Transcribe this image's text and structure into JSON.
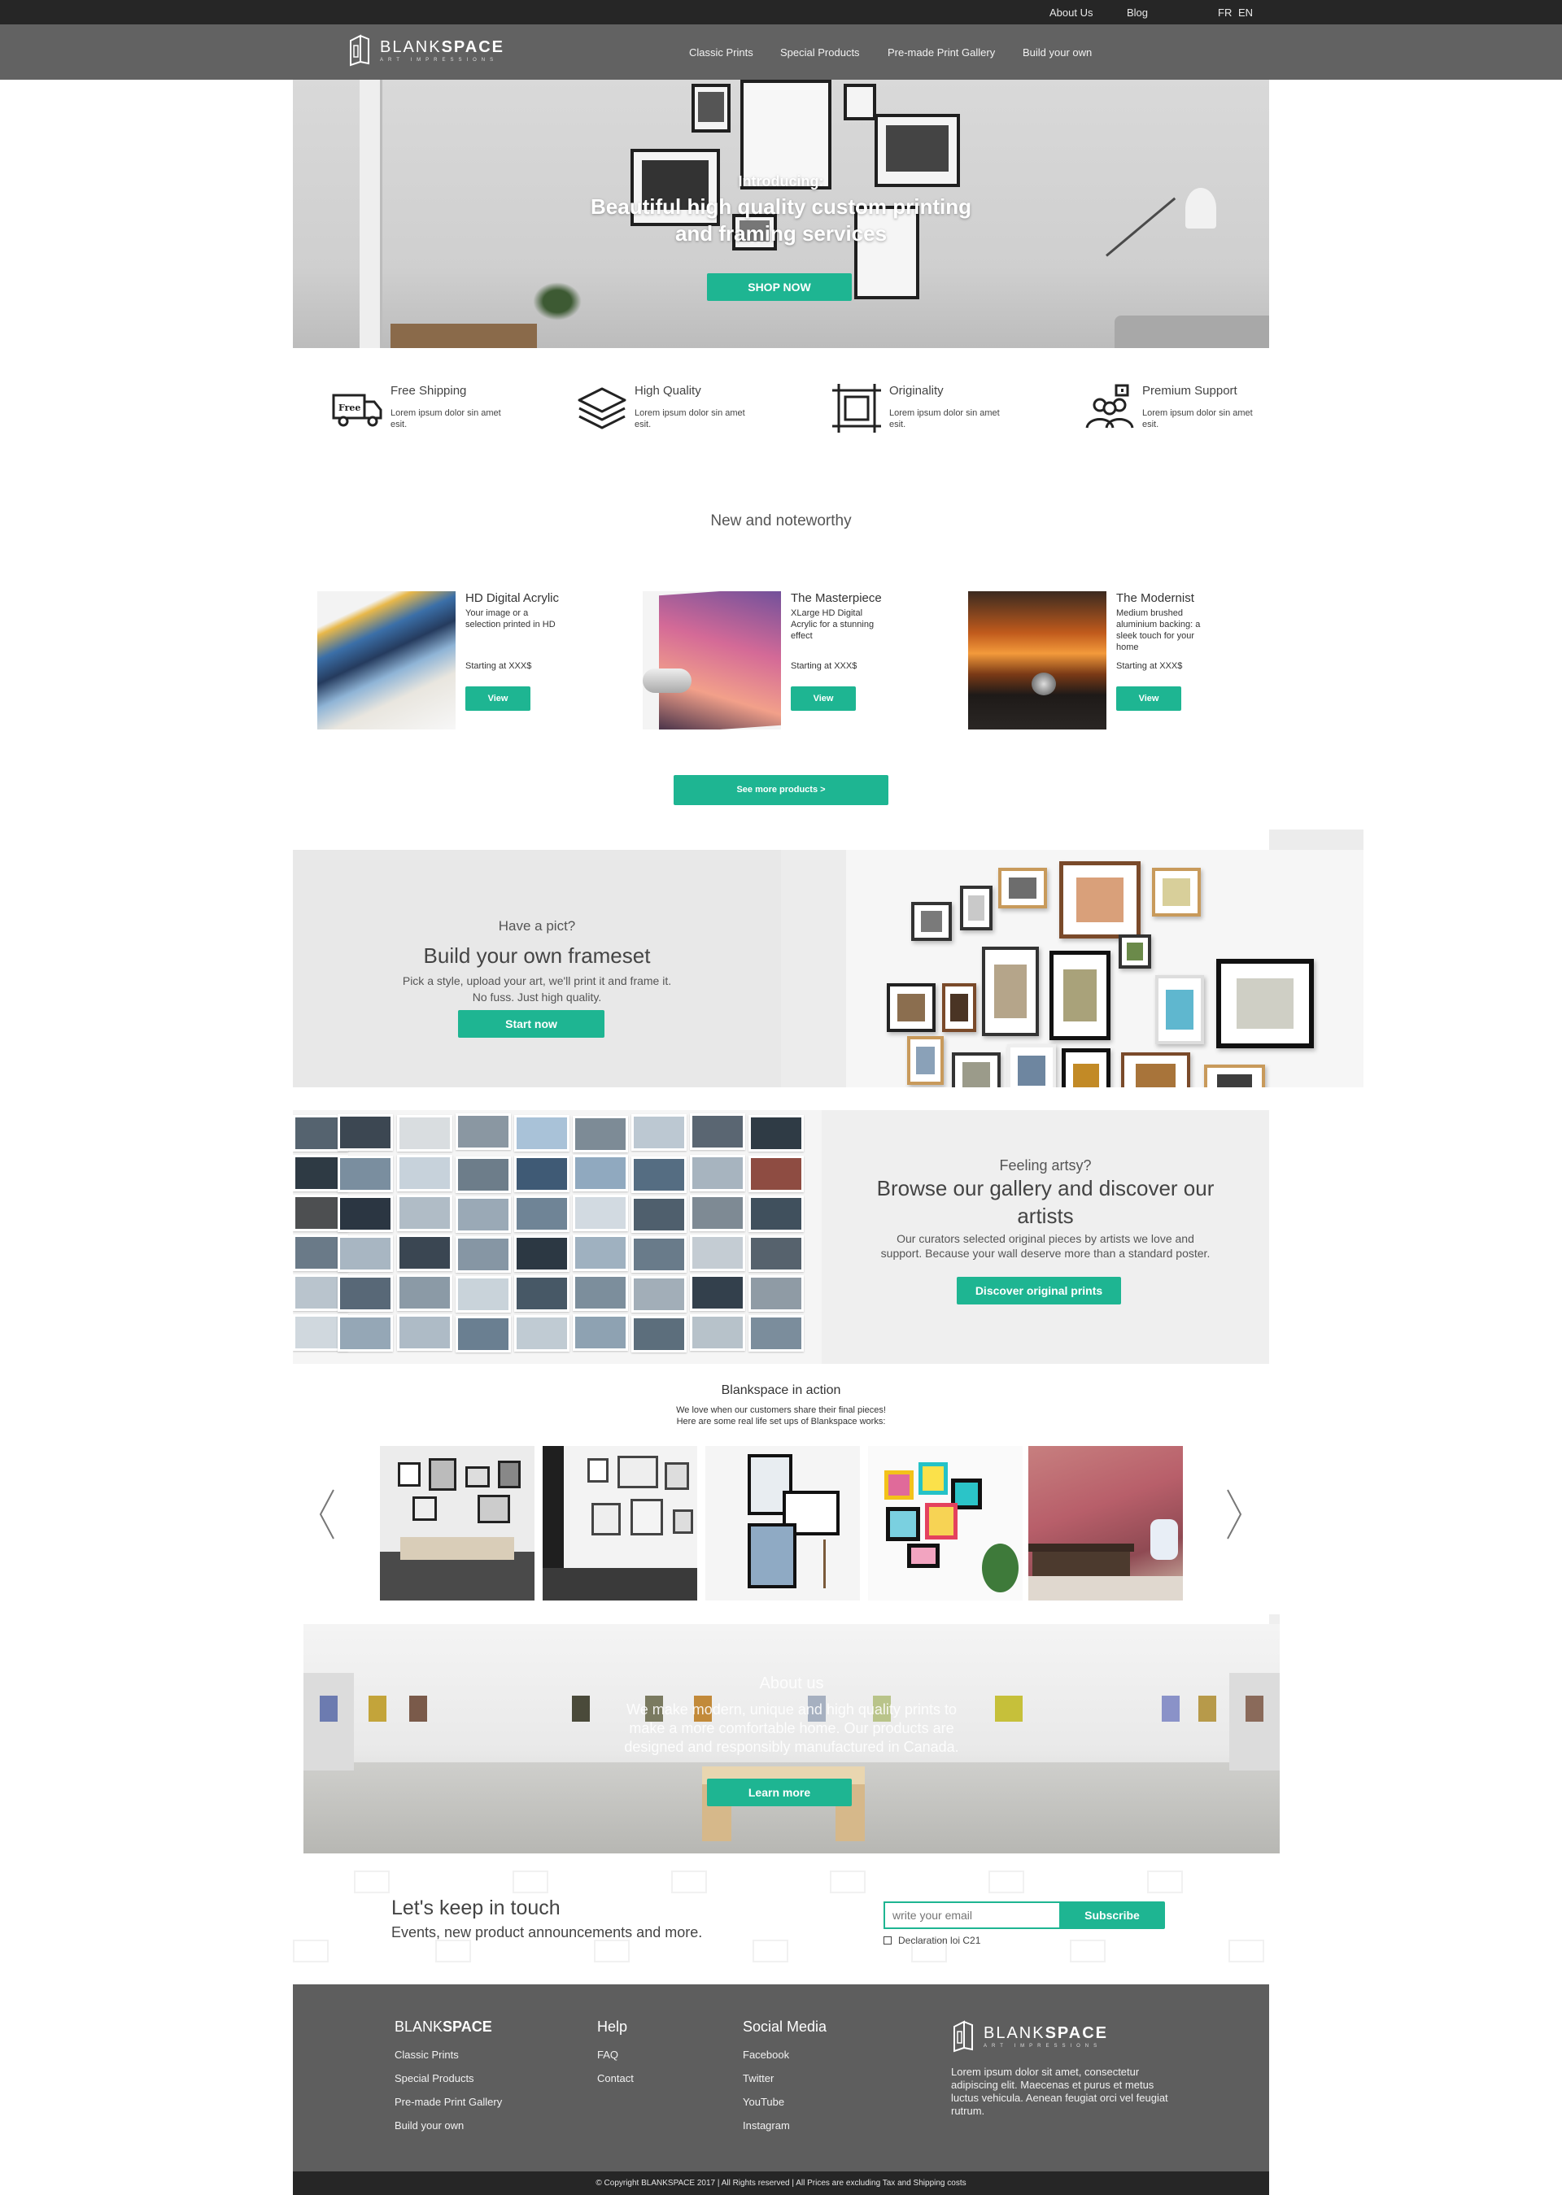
{
  "topbar": {
    "links": [
      "About Us",
      "Blog"
    ],
    "languages": [
      "FR",
      "EN"
    ]
  },
  "brand": {
    "name_light": "BLANK",
    "name_bold": "SPACE",
    "tagline": "ART IMPRESSIONS"
  },
  "nav": {
    "items": [
      "Classic Prints",
      "Special Products",
      "Pre-made Print Gallery",
      "Build your own"
    ]
  },
  "hero": {
    "kicker": "Introducing:",
    "headline_line1": "Beautiful high quality custom printing",
    "headline_line2": "and framing services",
    "cta": "SHOP NOW"
  },
  "features": [
    {
      "title": "Free Shipping",
      "desc": "Lorem ipsum dolor sin amet esit.",
      "icon": "delivery-truck-icon",
      "icon_text": "Free"
    },
    {
      "title": "High Quality",
      "desc": "Lorem ipsum dolor sin amet esit.",
      "icon": "layers-icon"
    },
    {
      "title": "Originality",
      "desc": "Lorem ipsum dolor sin amet esit.",
      "icon": "crop-frame-icon"
    },
    {
      "title": "Premium Support",
      "desc": "Lorem ipsum dolor sin amet esit.",
      "icon": "support-group-icon"
    }
  ],
  "noteworthy": {
    "title": "New and noteworthy",
    "products": [
      {
        "title": "HD Digital Acrylic",
        "desc": "Your image or a selection printed in HD",
        "price": "Starting at XXX$",
        "cta": "View"
      },
      {
        "title": "The Masterpiece",
        "desc": "XLarge HD Digital Acrylic for a stunning effect",
        "price": "Starting at XXX$",
        "cta": "View"
      },
      {
        "title": "The Modernist",
        "desc": "Medium brushed aluminium backing: a sleek touch for your home",
        "price": "Starting at XXX$",
        "cta": "View"
      }
    ],
    "more_cta": "See more products >"
  },
  "frameset": {
    "kicker": "Have a pict?",
    "title": "Build your own frameset",
    "line1": "Pick a style, upload your art, we'll print it and frame it.",
    "line2": "No fuss. Just high quality.",
    "cta": "Start now"
  },
  "gallery": {
    "kicker": "Feeling artsy?",
    "title_line1": "Browse our gallery and discover our",
    "title_line2": "artists",
    "line1": "Our curators selected original pieces by artists we love and",
    "line2": "support. Because your wall deserve more than a standard poster.",
    "cta": "Discover original prints"
  },
  "in_action": {
    "title": "Blankspace in action",
    "line1": "We love when our customers share their final pieces!",
    "line2": "Here are some real life set ups of Blankspace works:"
  },
  "about": {
    "title": "About us",
    "line1": "We make modern, unique and high quality prints to",
    "line2": "make a more comfortable home. Our products are",
    "line3": "designed and responsibly manufactured in Canada.",
    "cta": "Learn more"
  },
  "newsletter": {
    "title": "Let's keep in touch",
    "subtitle": "Events, new product announcements and more.",
    "placeholder": "write your email",
    "cta": "Subscribe",
    "checkbox_label": "Declaration loi C21"
  },
  "footer": {
    "brand_light": "BLANK",
    "brand_bold": "SPACE",
    "shop_links": [
      "Classic Prints",
      "Special Products",
      "Pre-made Print Gallery",
      "Build your own"
    ],
    "help_title": "Help",
    "help_links": [
      "FAQ",
      "Contact"
    ],
    "social_title": "Social Media",
    "social_links": [
      "Facebook",
      "Twitter",
      "YouTube",
      "Instagram"
    ],
    "about_text": "Lorem ipsum dolor sit amet, consectetur adipiscing elit. Maecenas et purus et metus luctus vehicula. Aenean feugiat orci vel feugiat rutrum.",
    "copyright": "© Copyright BLANKSPACE 2017 | All Rights reserved | All Prices are excluding Tax and Shipping costs"
  },
  "colors": {
    "accent": "#1eb592",
    "topbar": "#262626",
    "nav": "#626262",
    "footer": "#5e5e5e"
  }
}
